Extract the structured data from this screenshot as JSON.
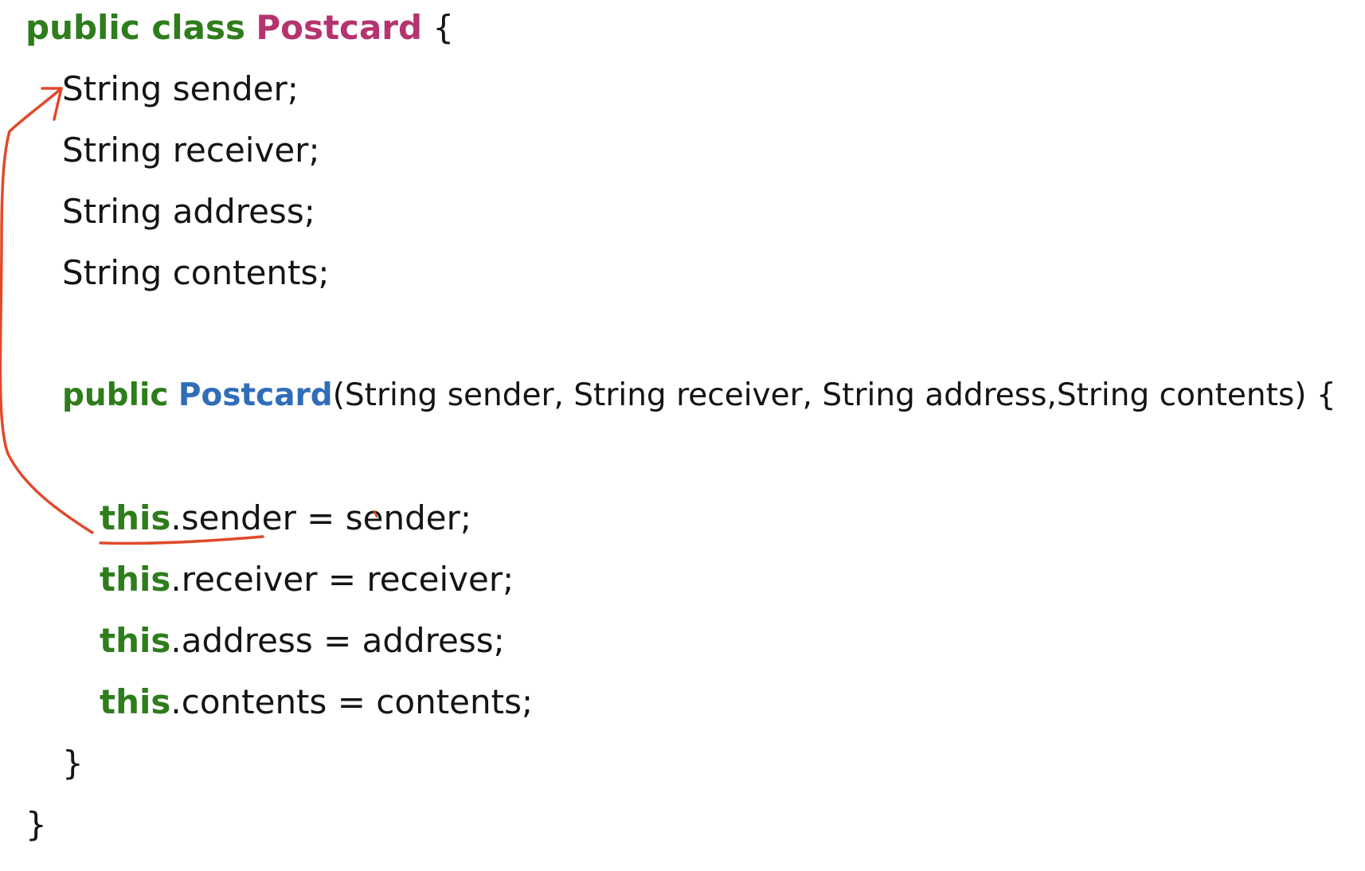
{
  "code": {
    "line1": {
      "kw": "public class",
      "sp": " ",
      "name": "Postcard",
      "rest": " {"
    },
    "line2": "String sender;",
    "line3": "String receiver;",
    "line4": "String address;",
    "line5": "String contents;",
    "line6": {
      "kw": "public",
      "sp": " ",
      "name": "Postcard",
      "rest": "(String sender, String receiver, String address,String contents) {"
    },
    "line7": {
      "kw": "this",
      "rest": ".sender = sender;"
    },
    "line8": {
      "kw": "this",
      "rest": ".receiver = receiver;"
    },
    "line9": {
      "kw": "this",
      "rest": ".address = address;"
    },
    "line10": {
      "kw": "this",
      "rest": ".contents = contents;"
    },
    "line11": "}",
    "line12": "}"
  },
  "colors": {
    "keyword": "#2e7d1c",
    "class_name": "#b5336e",
    "constructor_name": "#2f6db8",
    "text": "#141414",
    "annotation": "#e04a2a"
  }
}
